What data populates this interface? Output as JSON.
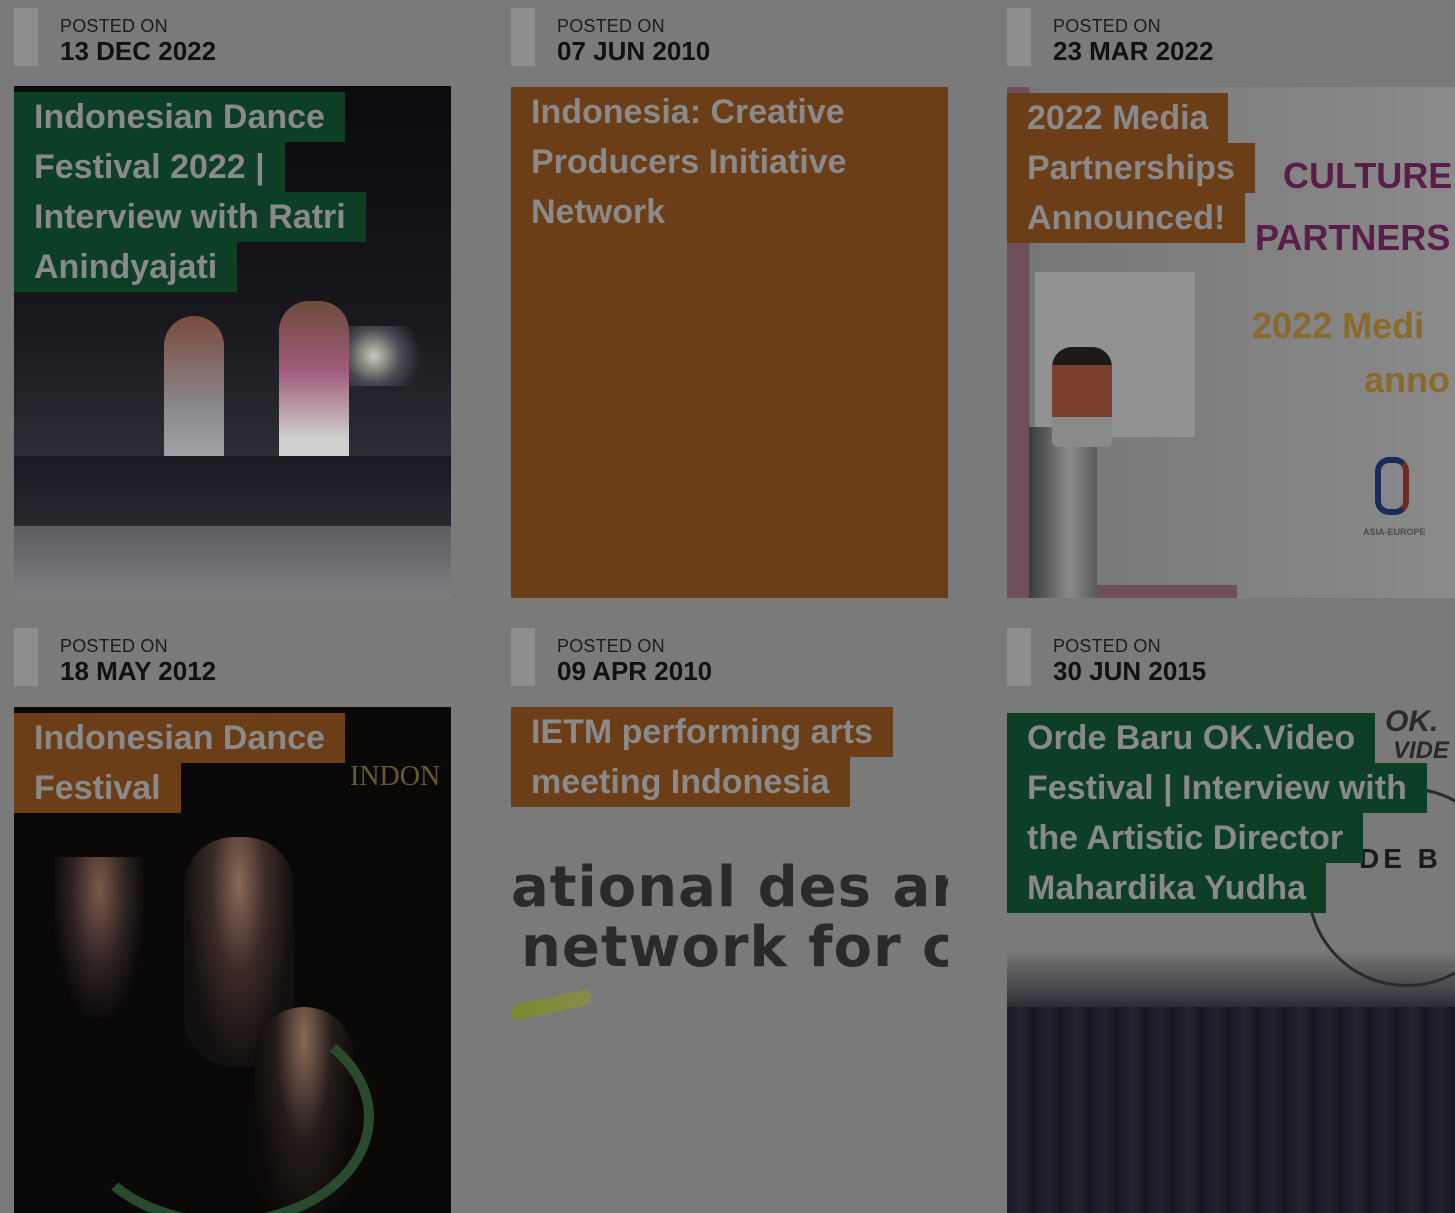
{
  "posts": [
    {
      "posted_label": "POSTED ON",
      "date": "13 DEC 2022",
      "title_lines": [
        "Indonesian Dance",
        "Festival 2022 |",
        "Interview with Ratri",
        "Anindyajati"
      ],
      "label_color": "#0d3f26",
      "image": "dance-performance-photo"
    },
    {
      "posted_label": "POSTED ON",
      "date": "07 JUN 2010",
      "title_lines": [
        "Indonesia: Creative",
        "Producers Initiative",
        "Network"
      ],
      "label_color": "#6b3e17",
      "image": "none"
    },
    {
      "posted_label": "POSTED ON",
      "date": "23 MAR 2022",
      "title_lines": [
        "2022 Media",
        "Partnerships",
        "Announced!"
      ],
      "label_color": "#6b3e17",
      "image": "media-partnerships-poster",
      "image_text": [
        "CULTURE",
        "PARTNERS",
        "2022 Medi",
        "anno",
        "ASIA-EUROPE"
      ]
    },
    {
      "posted_label": "POSTED ON",
      "date": "18 MAY 2012",
      "title_lines": [
        "Indonesian Dance",
        "Festival"
      ],
      "label_color": "#6b3e17",
      "image": "festival-dancers-photo",
      "image_text": [
        "INDON"
      ]
    },
    {
      "posted_label": "POSTED ON",
      "date": "09 APR 2010",
      "title_lines": [
        "IETM performing arts",
        "meeting Indonesia"
      ],
      "label_color": "#6b3e17",
      "image": "ietm-logo",
      "image_text": [
        "ational des arts c",
        "network for cont"
      ]
    },
    {
      "posted_label": "POSTED ON",
      "date": "30 JUN 2015",
      "title_lines": [
        "Orde Baru OK.Video",
        "Festival | Interview with",
        "the Artistic Director",
        "Mahardika Yudha"
      ],
      "label_color": "#0d3f26",
      "image": "okvideo-festival-photo",
      "image_text": [
        "OK.",
        "VIDE",
        "DE B"
      ]
    }
  ]
}
